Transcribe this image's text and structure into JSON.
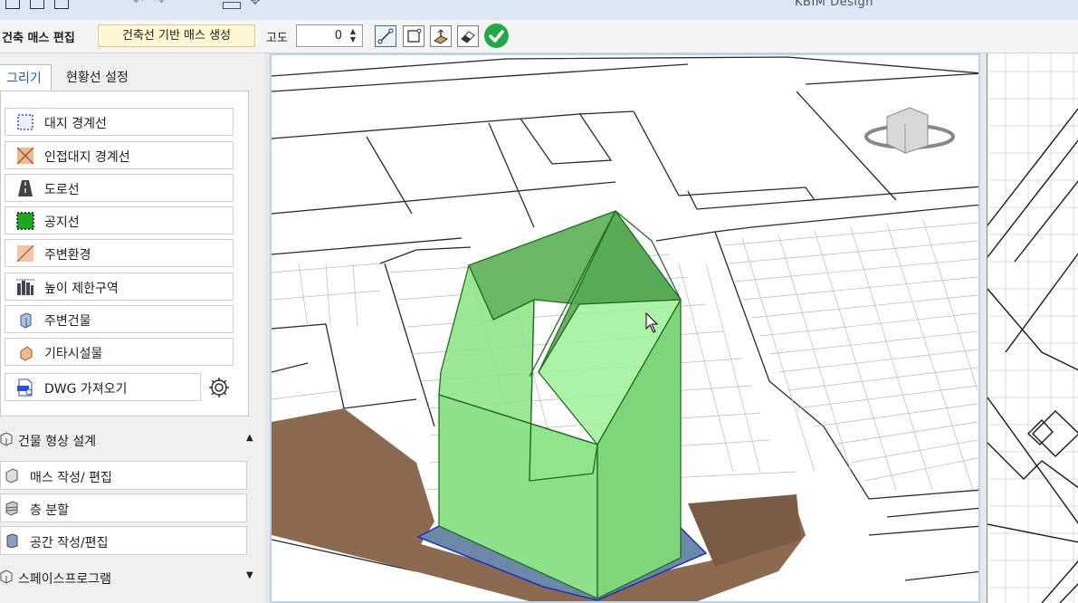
{
  "window": {
    "app_title": "KBIM Design"
  },
  "toolbar": {
    "mode_label": "건축 매스 편집",
    "generate_button": "건축선 기반 매스 생성",
    "altitude_label": "고도",
    "altitude_value": "0"
  },
  "tabs": [
    {
      "label": "그리기",
      "active": true
    },
    {
      "label": "현황선 설정",
      "active": false
    }
  ],
  "draw_tools": [
    {
      "label": "대지 경계선",
      "icon": "boundary-icon"
    },
    {
      "label": "인접대지 경계선",
      "icon": "adjacent-boundary-icon"
    },
    {
      "label": "도로선",
      "icon": "road-icon"
    },
    {
      "label": "공지선",
      "icon": "open-space-icon"
    },
    {
      "label": "주변환경",
      "icon": "surroundings-icon"
    },
    {
      "label": "높이 제한구역",
      "icon": "height-limit-icon"
    },
    {
      "label": "주변건물",
      "icon": "nearby-building-icon"
    },
    {
      "label": "기타시설물",
      "icon": "facility-icon"
    }
  ],
  "import": {
    "label": "DWG 가져오기"
  },
  "sections": {
    "building_shape": {
      "label": "건물 형상 설계",
      "items": [
        {
          "label": "매스 작성/ 편집"
        },
        {
          "label": "층 분할"
        },
        {
          "label": "공간 작성/편집"
        }
      ]
    },
    "space_program": {
      "label": "스페이스프로그램"
    }
  },
  "colors": {
    "accent": "#1d5fb3",
    "mass_fill": "#7fd67a",
    "ground": "#8b6a50",
    "ok_button": "#22a844",
    "generate_button_bg": "#fdf6d2"
  }
}
